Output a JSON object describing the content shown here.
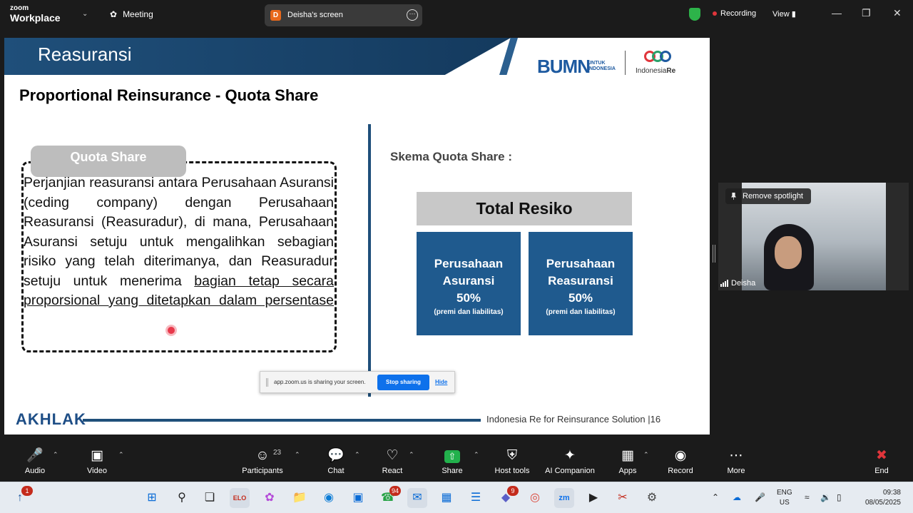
{
  "app": {
    "brand_top": "zoom",
    "brand_bottom": "Workplace",
    "meeting_label": "Meeting",
    "screen_title": "Deisha's screen",
    "screen_initial": "D",
    "recording_label": "Recording",
    "view_label": "View"
  },
  "slide": {
    "banner_title": "Reasuransi",
    "logo_bumn": "BUMN",
    "logo_bumn_sub1": "UNTUK",
    "logo_bumn_sub2": "INDONESIA",
    "logo_indre_a": "Indonesia",
    "logo_indre_b": "Re",
    "heading": "Proportional Reinsurance - Quota Share",
    "qs_label": "Quota Share",
    "para_plain": "Perjanjian reasuransi antara Perusahaan Asuransi (ceding company) dengan Perusahaan Reasuransi (Reasuradur), di mana, Perusahaan Asuransi setuju untuk mengalihkan sebagian risiko yang telah diterimanya, dan Reasuradur setuju untuk menerima ",
    "para_underlined": "bagian tetap secara proporsional yang ditetapkan dalam persentase",
    "skema_label": "Skema Quota Share :",
    "total_label": "Total Resiko",
    "box_left": {
      "line1": "Perusahaan",
      "line2": "Asuransi",
      "pct": "50%",
      "note": "(premi dan liabilitas)"
    },
    "box_right": {
      "line1": "Perusahaan",
      "line2": "Reasuransi",
      "pct": "50%",
      "note": "(premi dan liabilitas)"
    },
    "footer_logo": "AKHLAK",
    "footer_text": "Indonesia Re for Reinsurance Solution",
    "page_number": "|16"
  },
  "share_bar": {
    "message": "app.zoom.us is sharing your screen.",
    "stop_label": "Stop sharing",
    "hide_label": "Hide"
  },
  "video": {
    "spotlight_label": "Remove spotlight",
    "participant_name": "Deisha"
  },
  "toolbar": {
    "audio": "Audio",
    "video": "Video",
    "participants": "Participants",
    "participants_count": "23",
    "chat": "Chat",
    "react": "React",
    "share": "Share",
    "host_tools": "Host tools",
    "ai_companion": "AI Companion",
    "apps": "Apps",
    "record": "Record",
    "more": "More",
    "end": "End"
  },
  "taskbar": {
    "notif_badge": "1",
    "whatsapp_badge": "94",
    "teams_badge": "9",
    "elo_label": "ELO",
    "zoom_label": "zm",
    "lang_line1": "ENG",
    "lang_line2": "US",
    "time": "09:38",
    "date": "08/05/2025"
  },
  "icons": {
    "audio": "mic-muted-icon",
    "video": "camera-icon",
    "participants": "people-icon",
    "chat": "chat-icon",
    "react": "heart-icon",
    "share": "share-arrow-icon",
    "host_tools": "shield-icon",
    "ai": "sparkle-icon",
    "apps": "apps-icon",
    "record": "record-icon",
    "more": "more-icon",
    "end": "end-icon"
  },
  "colors": {
    "zoom_blue": "#0e71eb",
    "slide_navy": "#1f4f7a",
    "box_blue": "#1f5a8e",
    "share_green": "#22b14c",
    "end_red": "#e0353b"
  }
}
